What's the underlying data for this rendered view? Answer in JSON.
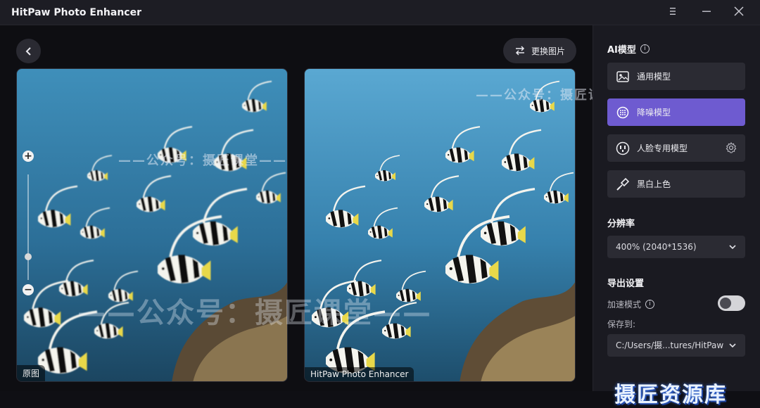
{
  "app": {
    "title": "HitPaw Photo Enhancer"
  },
  "toolbar": {
    "replace_label": "更换图片"
  },
  "panels": {
    "left_label": "原图",
    "right_label": "HitPaw Photo Enhancer"
  },
  "watermarks": {
    "small": "——公众号：摄匠课堂——",
    "large": "——公众号：摄匠课堂——"
  },
  "sidebar": {
    "ai_model_title": "AI模型",
    "models": [
      {
        "label": "通用模型",
        "icon": "image-icon",
        "active": false
      },
      {
        "label": "降噪模型",
        "icon": "denoise-icon",
        "active": true
      },
      {
        "label": "人脸专用模型",
        "icon": "face-icon",
        "active": false
      },
      {
        "label": "黑白上色",
        "icon": "brush-icon",
        "active": false
      }
    ],
    "resolution_title": "分辨率",
    "resolution_value": "400% (2040*1536)",
    "export_title": "导出设置",
    "accelerate_label": "加速模式",
    "accelerate_on": false,
    "save_to_label": "保存到:",
    "save_path": "C:/Users/摄...tures/HitPaw",
    "brand_text": "摄匠资源库"
  },
  "colors": {
    "accent": "#6e5bd0",
    "panel_bg": "#1a1a21",
    "button_bg": "#2b2b33"
  }
}
